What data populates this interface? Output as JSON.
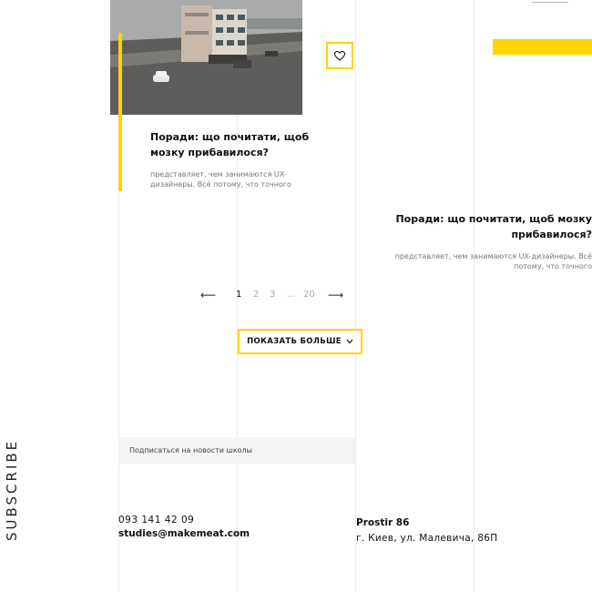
{
  "card1": {
    "title_line1": "Поради: що почитати, щоб",
    "title_line2": "мозку прибавилося?",
    "excerpt_line1": "представляет, чем занимаются UX-",
    "excerpt_line2": "дизайнеры. Всё потому, что точного"
  },
  "card2": {
    "title_line1": "Поради: що почитати, щоб мозку",
    "title_line2": "прибавилося?",
    "excerpt_line1": "представляет, чем занимаются UX-дизайнеры. Всё",
    "excerpt_line2": "потому, что точного"
  },
  "favorite": {
    "icon": "heart-icon"
  },
  "pagination": {
    "prev": "⟵",
    "next": "⟶",
    "pages": [
      "1",
      "2",
      "3",
      "...",
      "20"
    ],
    "current": "1"
  },
  "show_more": {
    "label": "ПОКАЗАТЬ БОЛЬШЕ",
    "icon": "chevron-down-icon"
  },
  "subscribe": {
    "vertical_label": "SUBSCRIBE",
    "field_label": "Подписаться на новости школы"
  },
  "contacts": {
    "phone": "093 141 42 09",
    "email": "studies@makemeat.com",
    "venue": "Prostir 86",
    "address": "г. Киев, ул. Малевича, 86П"
  },
  "colors": {
    "accent": "#ffd400",
    "grid": "#ececec",
    "text": "#111111",
    "muted": "#777777"
  }
}
